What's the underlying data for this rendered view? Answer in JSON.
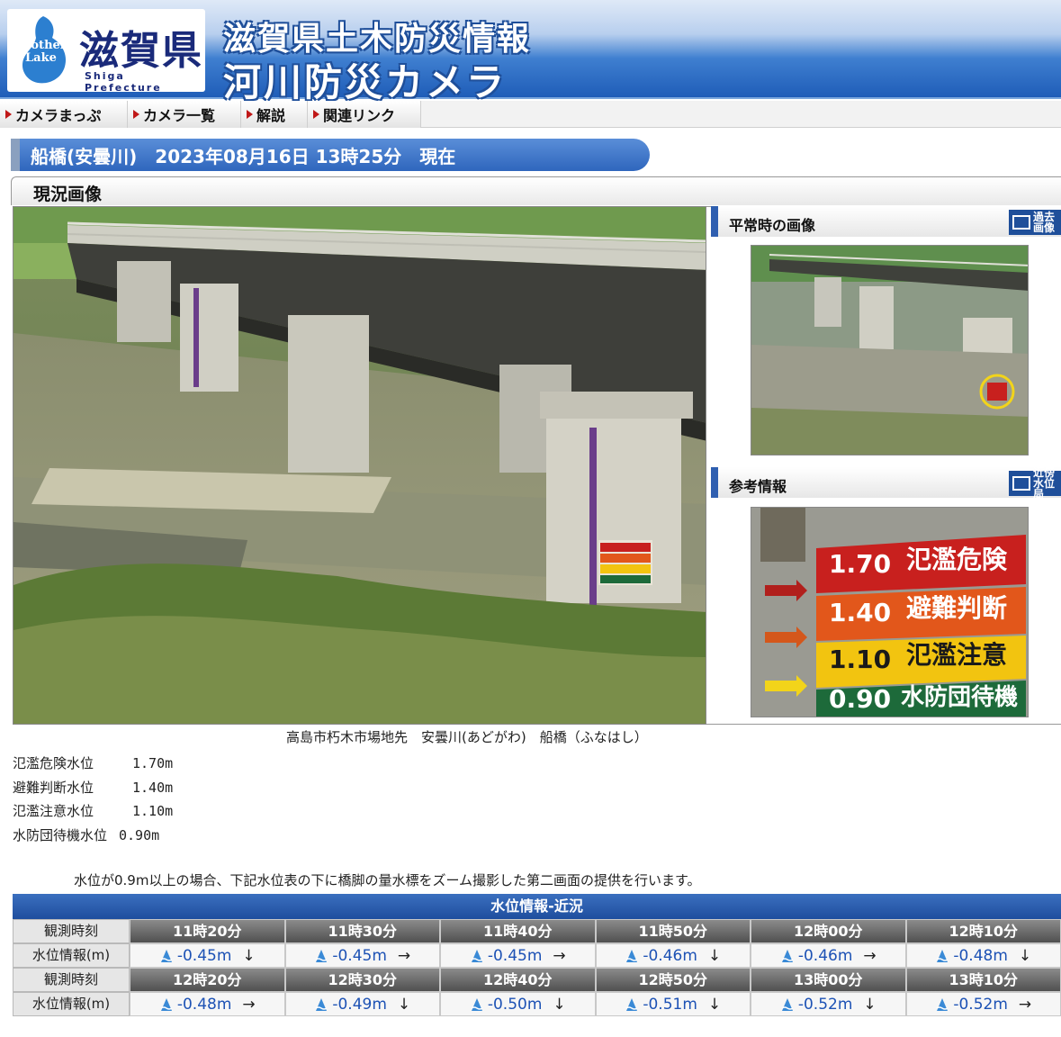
{
  "header": {
    "logo_text": "滋賀県",
    "logo_sub": "Shiga Prefecture",
    "logo_badge": "Mother Lake",
    "title_line1": "滋賀県土木防災情報",
    "title_line2": "河川防災カメラ"
  },
  "nav": {
    "items": [
      {
        "label": "カメラまっぷ"
      },
      {
        "label": "カメラ一覧"
      },
      {
        "label": "解説"
      },
      {
        "label": "関連リンク"
      }
    ]
  },
  "banner": {
    "text": "船橋(安曇川)　2023年08月16日 13時25分　現在"
  },
  "section": {
    "title": "現況画像"
  },
  "side": {
    "normal_title": "平常時の画像",
    "normal_button": "過去画像",
    "ref_title": "参考情報",
    "ref_button": "近傍水位局"
  },
  "gauge_sign": {
    "rows": [
      {
        "value": "1.70",
        "label": "氾濫危険",
        "color": "#c8201e"
      },
      {
        "value": "1.40",
        "label": "避難判断",
        "color": "#e2571b"
      },
      {
        "value": "1.10",
        "label": "氾濫注意",
        "color": "#f2c410"
      },
      {
        "value": "0.90",
        "label": "水防団待機",
        "color": "#1d6a3a"
      }
    ]
  },
  "caption": "高島市朽木市場地先　安曇川(あどがわ)　船橋（ふなはし）",
  "levels": [
    {
      "label": "氾濫危険水位",
      "value": "　1.70m"
    },
    {
      "label": "避難判断水位",
      "value": "　1.40m"
    },
    {
      "label": "氾濫注意水位",
      "value": "　1.10m"
    },
    {
      "label": "水防団待機水位",
      "value": "0.90m"
    }
  ],
  "notice": "水位が0.9m以上の場合、下記水位表の下に橋脚の量水標をズーム撮影した第二画面の提供を行います。",
  "water_table": {
    "title": "水位情報-近況",
    "time_label": "観測時刻",
    "value_label": "水位情報(m)",
    "rows": [
      {
        "times": [
          "11時20分",
          "11時30分",
          "11時40分",
          "11時50分",
          "12時00分",
          "12時10分"
        ],
        "values": [
          "-0.45m",
          "-0.45m",
          "-0.45m",
          "-0.46m",
          "-0.46m",
          "-0.48m"
        ],
        "arrows": [
          "↓",
          "→",
          "→",
          "↓",
          "→",
          "↓"
        ]
      },
      {
        "times": [
          "12時20分",
          "12時30分",
          "12時40分",
          "12時50分",
          "13時00分",
          "13時10分"
        ],
        "values": [
          "-0.48m",
          "-0.49m",
          "-0.50m",
          "-0.51m",
          "-0.52m",
          "-0.52m"
        ],
        "arrows": [
          "→",
          "↓",
          "↓",
          "↓",
          "↓",
          "→"
        ]
      }
    ]
  }
}
